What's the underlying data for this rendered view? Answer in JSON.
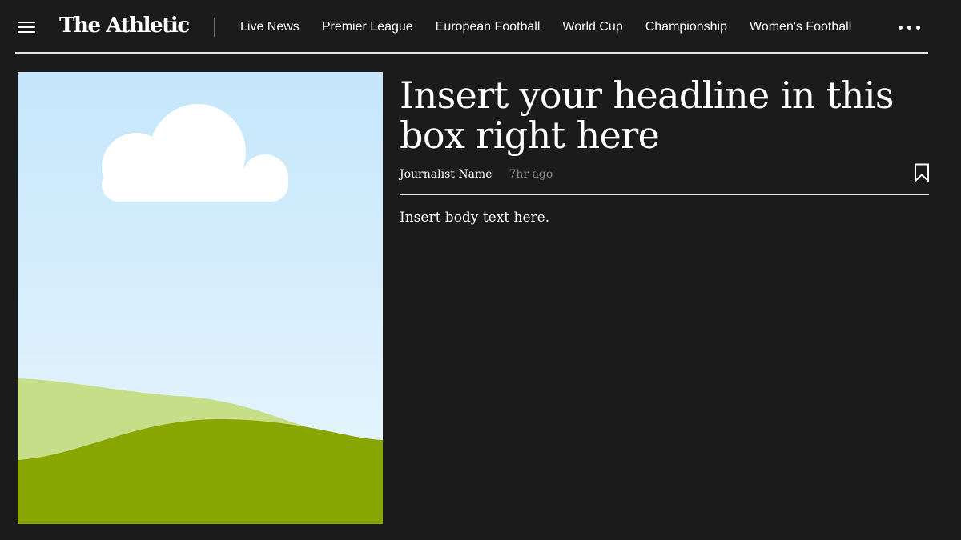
{
  "header": {
    "brand": "The Athletic",
    "nav_items": [
      "Live News",
      "Premier League",
      "European Football",
      "World Cup",
      "Championship",
      "Women's Football"
    ],
    "menu_icon": "hamburger-menu-icon",
    "more_icon": "more-horizontal-icon"
  },
  "article": {
    "headline": "Insert your headline in this box right here",
    "author": "Journalist Name",
    "timestamp": "7hr ago",
    "bookmark_icon": "bookmark-icon",
    "body": "Insert body text here."
  },
  "colors": {
    "background": "#1b1b1b",
    "text": "#ffffff",
    "muted_text": "#8a8a8a",
    "rule": "#e6e6e6",
    "sky_top": "#c5e6fb",
    "sky_bottom": "#eaf7fd",
    "cloud": "#ffffff",
    "hill_light": "#c6de87",
    "hill_dark": "#89a501"
  }
}
